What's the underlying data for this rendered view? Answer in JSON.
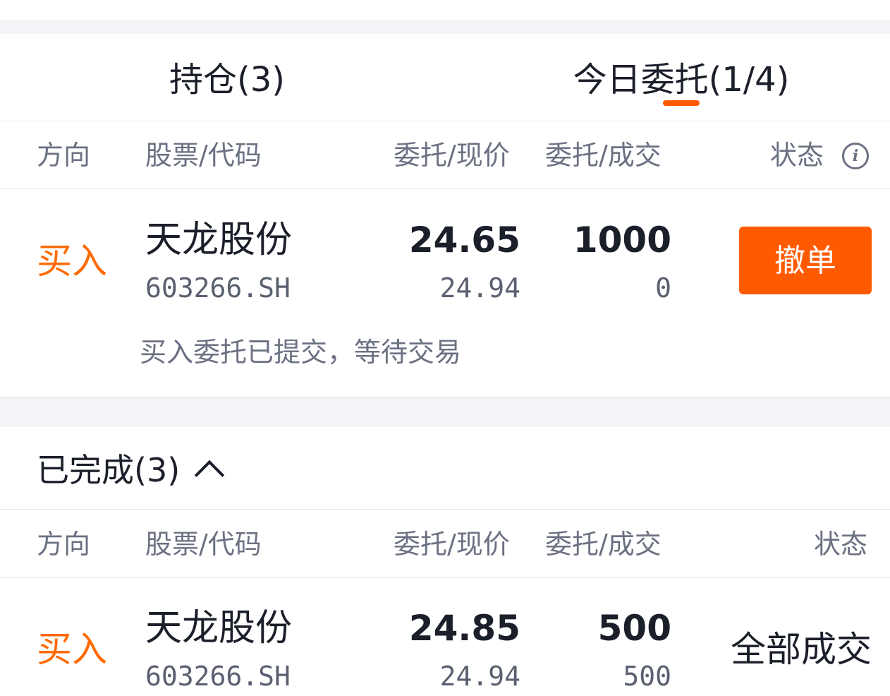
{
  "tabs": {
    "holdings": "持仓(3)",
    "today_orders": "今日委托(1/4)"
  },
  "table_header": {
    "direction": "方向",
    "stock_code": "股票/代码",
    "order_current_price": "委托/现价",
    "order_filled": "委托/成交",
    "status": "状态"
  },
  "pending_order": {
    "direction": "买入",
    "name": "天龙股份",
    "code": "603266.SH",
    "order_price": "24.65",
    "current_price": "24.94",
    "order_qty": "1000",
    "filled_qty": "0",
    "action": "撤单",
    "note": "买入委托已提交，等待交易"
  },
  "completed": {
    "title": "已完成(3)",
    "header": {
      "direction": "方向",
      "stock_code": "股票/代码",
      "order_current_price": "委托/现价",
      "order_filled": "委托/成交",
      "status": "状态"
    },
    "rows": [
      {
        "direction": "买入",
        "name": "天龙股份",
        "code": "603266.SH",
        "order_price": "24.85",
        "current_price": "24.94",
        "order_qty": "500",
        "filled_qty": "500",
        "status": "全部成交"
      }
    ]
  },
  "colors": {
    "accent": "#ff5a00",
    "buy": "#ff6a00",
    "band": "#f3f4f7"
  }
}
